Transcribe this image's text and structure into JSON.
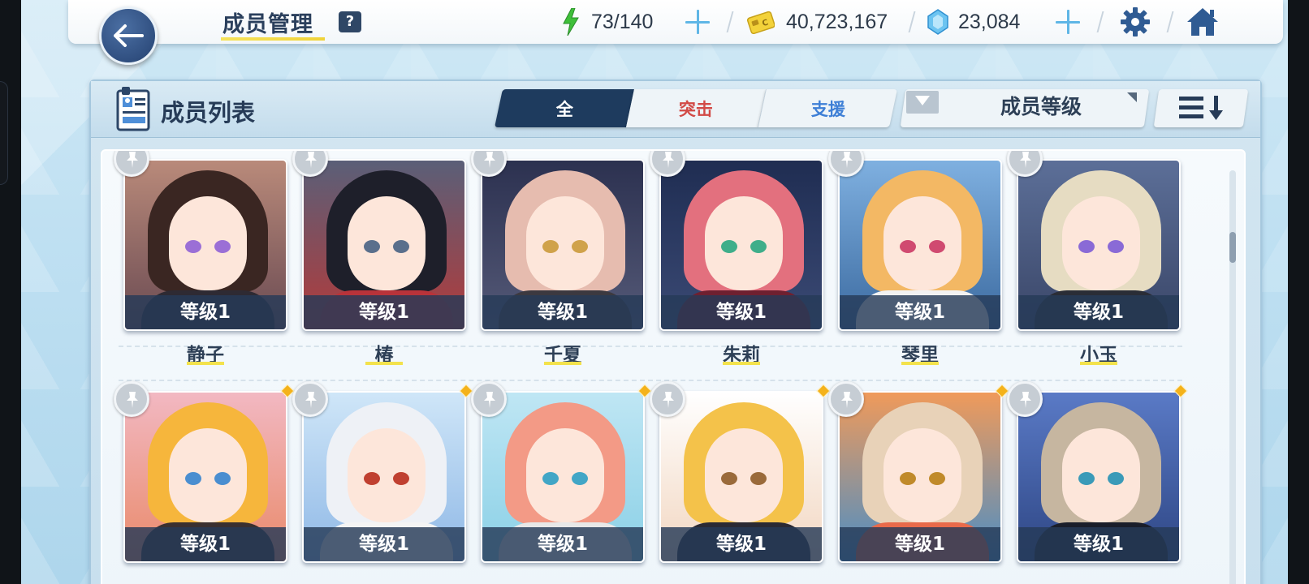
{
  "topbar": {
    "title": "成员管理",
    "help": "?",
    "ap": "73/140",
    "credits": "40,723,167",
    "gems": "23,084"
  },
  "panel": {
    "title": "成员列表",
    "tabs": [
      "全",
      "突击",
      "支援"
    ],
    "filter_label": "成员等级"
  },
  "members_row1": [
    {
      "name": "静子",
      "level": "等级1"
    },
    {
      "name": "椿",
      "level": "等级1"
    },
    {
      "name": "千夏",
      "level": "等级1"
    },
    {
      "name": "朱莉",
      "level": "等级1"
    },
    {
      "name": "琴里",
      "level": "等级1"
    },
    {
      "name": "小玉",
      "level": "等级1"
    }
  ],
  "members_row2": [
    {
      "level": "等级1"
    },
    {
      "level": "等级1"
    },
    {
      "level": "等级1"
    },
    {
      "level": "等级1"
    },
    {
      "level": "等级1"
    },
    {
      "level": "等级1"
    }
  ],
  "colors": {
    "accent_dark": "#1e3b5e",
    "strike_red": "#d24a46",
    "support_blue": "#3e7fd6",
    "gem_gold": "#f4b21b"
  },
  "icons": [
    "back-arrow-icon",
    "help-icon",
    "energy-bolt-icon",
    "credit-card-icon",
    "gem-icon",
    "gear-icon",
    "home-icon",
    "member-list-icon",
    "filter-icon",
    "sort-icon",
    "pin-icon"
  ]
}
